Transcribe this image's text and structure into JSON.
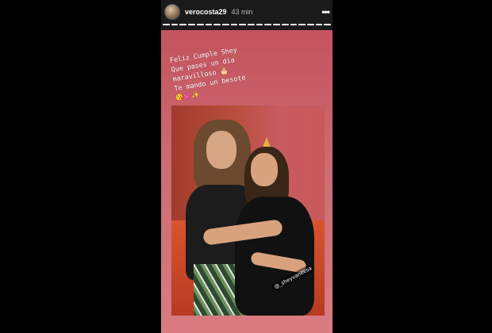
{
  "header": {
    "username": "verocosta29",
    "timestamp": "43 min",
    "more_icon": "more-horizontal-icon"
  },
  "progress": {
    "segments": 20,
    "current_segment": 20
  },
  "caption": {
    "lines": [
      "Feliz Cumple Shey",
      "Que pases un día",
      "maravilloso 🎂",
      "Te mando un besote"
    ],
    "emojis": "😘💕✨"
  },
  "photo": {
    "tag": "@_sheyvaneesa"
  },
  "colors": {
    "background": "#000000",
    "canvas_top": "#c4535d",
    "canvas_bottom": "#d97c82"
  }
}
